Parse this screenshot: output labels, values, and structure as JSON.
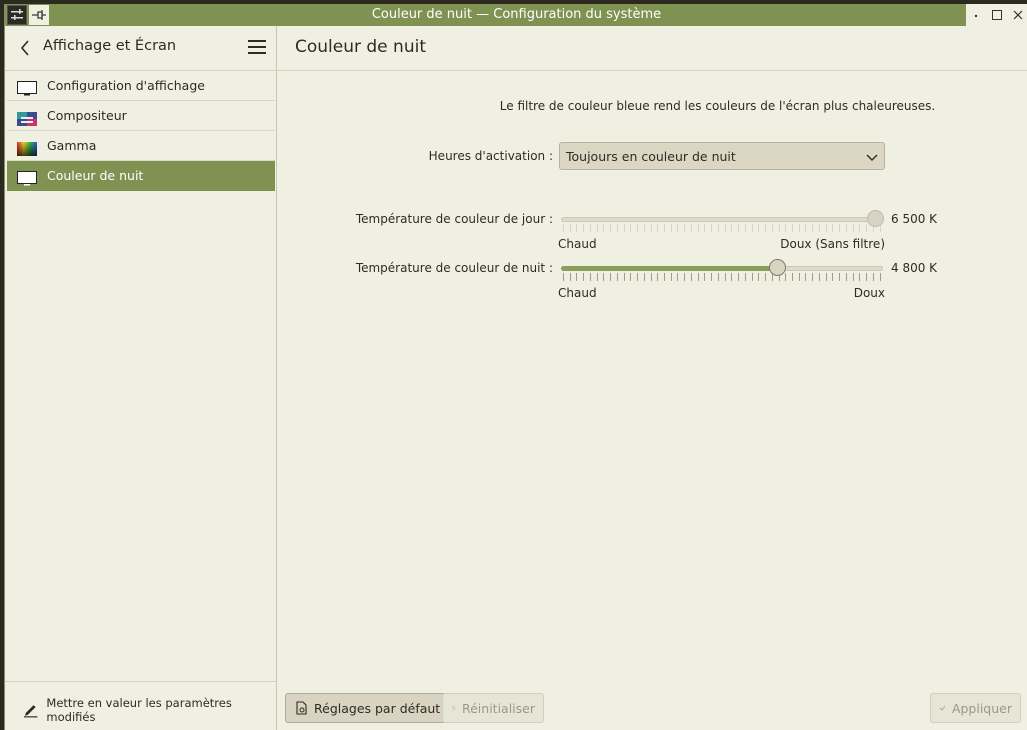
{
  "window": {
    "title": "Couleur de nuit — Configuration du système"
  },
  "sidebar": {
    "title": "Affichage et Écran",
    "items": [
      {
        "label": "Configuration d'affichage",
        "icon": "monitor-icon"
      },
      {
        "label": "Compositeur",
        "icon": "compositor-icon"
      },
      {
        "label": "Gamma",
        "icon": "gamma-icon"
      },
      {
        "label": "Couleur de nuit",
        "icon": "monitor-icon"
      }
    ],
    "active_index": 3,
    "footer_label": "Mettre en valeur les paramètres modifiés"
  },
  "main": {
    "title": "Couleur de nuit",
    "description": "Le filtre de couleur bleue rend les couleurs de l'écran plus chaleureuses.",
    "activation": {
      "label": "Heures d'activation :",
      "value": "Toujours en couleur de nuit"
    },
    "day_temp": {
      "label": "Température de couleur de jour :",
      "value": "6 500 K",
      "level": 1.0,
      "min_label": "Chaud",
      "max_label": "Doux (Sans filtre)",
      "enabled": false
    },
    "night_temp": {
      "label": "Température de couleur de nuit :",
      "value": "4 800 K",
      "level": 0.68,
      "min_label": "Chaud",
      "max_label": "Doux",
      "enabled": true
    }
  },
  "buttons": {
    "defaults": "Réglages par défaut",
    "reset": "Réinitialiser",
    "apply": "Appliquer"
  },
  "colors": {
    "accent": "#7f9252",
    "background": "#efefe2"
  }
}
